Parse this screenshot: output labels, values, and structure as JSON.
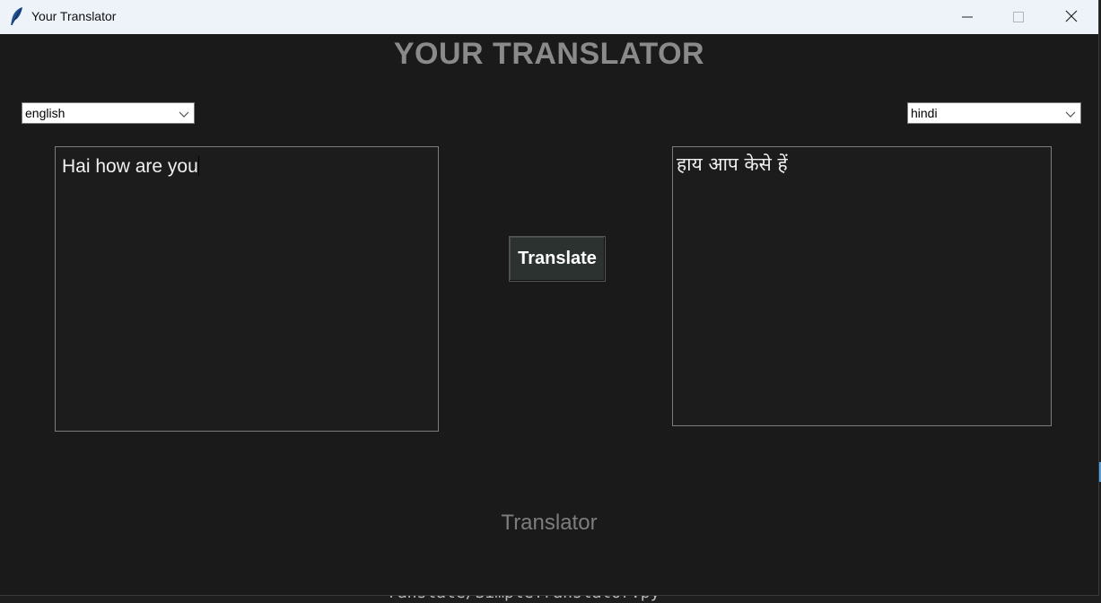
{
  "window": {
    "title": "Your Translator"
  },
  "header": {
    "title": "YOUR TRANSLATOR"
  },
  "source": {
    "language": "english",
    "text": "Hai how are you"
  },
  "target": {
    "language": "hindi",
    "text": "हाय आप केसे हें"
  },
  "actions": {
    "translate_label": "Translate"
  },
  "footer": {
    "label": "Translator"
  },
  "background_window": {
    "partial_text": "ranslate/SimpleTranslator.py"
  },
  "icons": {
    "app": "feather-icon",
    "minimize": "minimize-icon",
    "maximize": "maximize-icon",
    "close": "close-icon",
    "dropdown": "chevron-down-icon"
  },
  "colors": {
    "window_bg": "#1a1a1a",
    "titlebar_bg": "#eef3fa",
    "heading_text": "#8a8a8a",
    "button_bg": "#2b3230",
    "button_text": "#ffffff",
    "textarea_border": "#7c7c7c"
  }
}
